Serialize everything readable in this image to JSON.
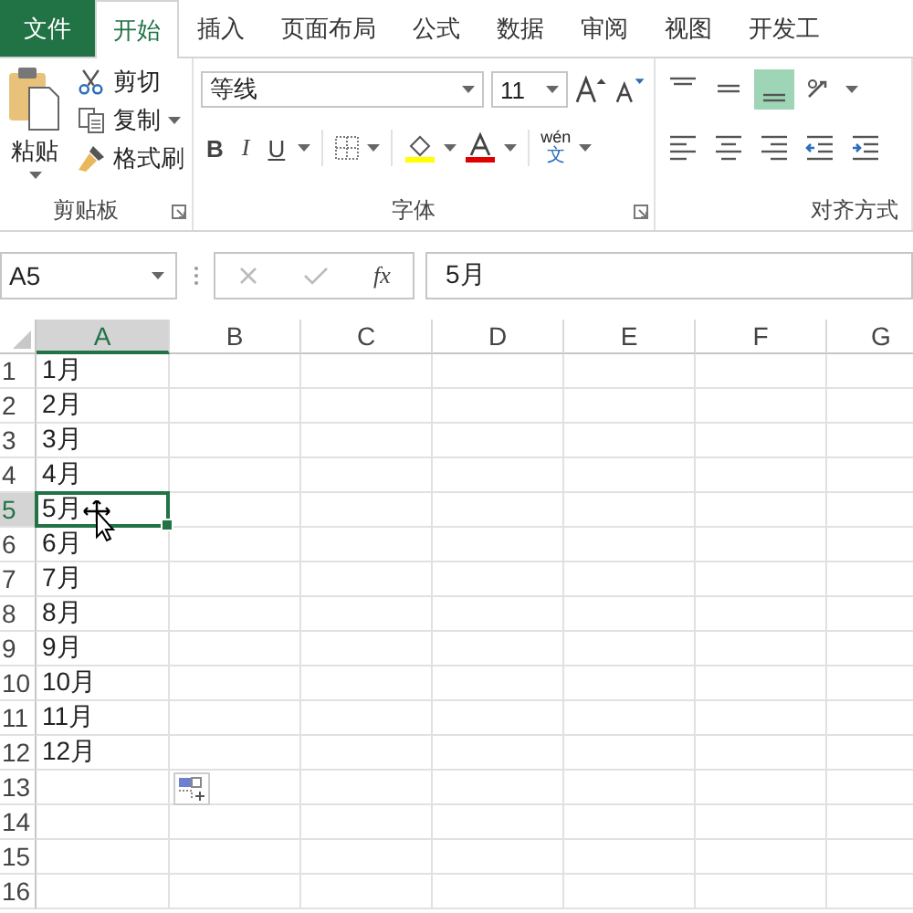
{
  "tabs": [
    {
      "label": "文件",
      "kind": "file",
      "selected": false
    },
    {
      "label": "开始",
      "kind": "tab",
      "selected": true
    },
    {
      "label": "插入",
      "kind": "tab",
      "selected": false
    },
    {
      "label": "页面布局",
      "kind": "tab",
      "selected": false
    },
    {
      "label": "公式",
      "kind": "tab",
      "selected": false
    },
    {
      "label": "数据",
      "kind": "tab",
      "selected": false
    },
    {
      "label": "审阅",
      "kind": "tab",
      "selected": false
    },
    {
      "label": "视图",
      "kind": "tab",
      "selected": false
    },
    {
      "label": "开发工",
      "kind": "tab",
      "selected": false
    }
  ],
  "clipboard": {
    "paste": "粘贴",
    "items": [
      {
        "kind": "cut",
        "label": "剪切"
      },
      {
        "kind": "copy",
        "label": "复制"
      },
      {
        "kind": "painter",
        "label": "格式刷"
      }
    ],
    "group_label": "剪贴板"
  },
  "font": {
    "font_name": "等线",
    "font_size": "11",
    "bold": "B",
    "italic": "I",
    "underline": "U",
    "phonetic_top": "wén",
    "phonetic_bottom": "文",
    "group_label": "字体"
  },
  "alignment": {
    "top_row": [
      {
        "kind": "top",
        "selected": false
      },
      {
        "kind": "middle",
        "selected": false
      },
      {
        "kind": "bottom",
        "selected": true
      },
      {
        "kind": "orient",
        "selected": false
      }
    ],
    "bottom_row": [
      {
        "kind": "left",
        "selected": false
      },
      {
        "kind": "center",
        "selected": false
      },
      {
        "kind": "right",
        "selected": false
      },
      {
        "kind": "outdent",
        "selected": false
      },
      {
        "kind": "indent",
        "selected": false
      }
    ],
    "group_label": "对齐方式"
  },
  "formula_bar": {
    "name_box": "A5",
    "function_label": "fx",
    "formula": "5月"
  },
  "columns": [
    {
      "label": "A",
      "selected": true
    },
    {
      "label": "B",
      "selected": false
    },
    {
      "label": "C",
      "selected": false
    },
    {
      "label": "D",
      "selected": false
    },
    {
      "label": "E",
      "selected": false
    },
    {
      "label": "F",
      "selected": false
    },
    {
      "label": "G",
      "selected": false
    }
  ],
  "rows": [
    {
      "number": "1",
      "selected": false,
      "value": "1月"
    },
    {
      "number": "2",
      "selected": false,
      "value": "2月"
    },
    {
      "number": "3",
      "selected": false,
      "value": "3月"
    },
    {
      "number": "4",
      "selected": false,
      "value": "4月"
    },
    {
      "number": "5",
      "selected": true,
      "value": "5月"
    },
    {
      "number": "6",
      "selected": false,
      "value": "6月"
    },
    {
      "number": "7",
      "selected": false,
      "value": "7月"
    },
    {
      "number": "8",
      "selected": false,
      "value": "8月"
    },
    {
      "number": "9",
      "selected": false,
      "value": "9月"
    },
    {
      "number": "10",
      "selected": false,
      "value": "10月"
    },
    {
      "number": "11",
      "selected": false,
      "value": "11月"
    },
    {
      "number": "12",
      "selected": false,
      "value": "12月"
    },
    {
      "number": "13",
      "selected": false
    },
    {
      "number": "14",
      "selected": false
    },
    {
      "number": "15",
      "selected": false
    },
    {
      "number": "16",
      "selected": false
    }
  ]
}
